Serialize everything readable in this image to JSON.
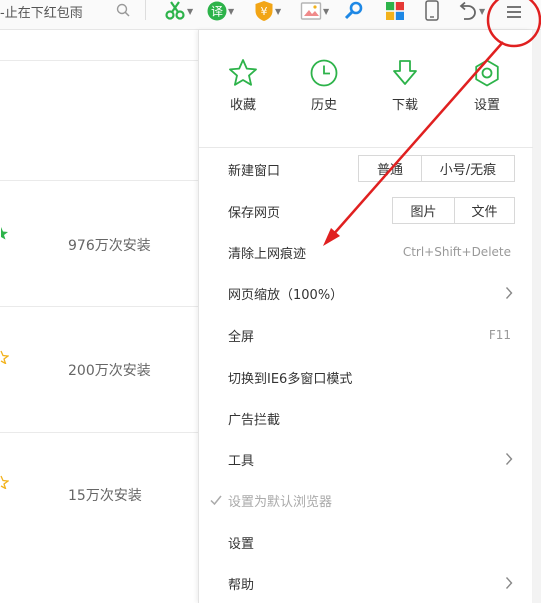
{
  "toolbar": {
    "search_text": "-止在下红包雨",
    "icons": [
      "scissors-icon",
      "translate-icon",
      "shield-icon",
      "image-icon",
      "search-icon",
      "apps-icon",
      "phone-icon",
      "undo-icon",
      "menu-icon"
    ],
    "translate_glyph": "译",
    "shield_glyph": "¥"
  },
  "page": {
    "rows": [
      {
        "install_count": "976万次安装",
        "star_color": "#2db34a"
      },
      {
        "install_count": "200万次安装",
        "star_color": "#f2b21c"
      },
      {
        "install_count": "15万次安装",
        "star_color": "#f2b21c"
      }
    ]
  },
  "menu": {
    "quick": [
      {
        "label": "收藏",
        "icon": "star-icon"
      },
      {
        "label": "历史",
        "icon": "clock-icon"
      },
      {
        "label": "下载",
        "icon": "download-icon"
      },
      {
        "label": "设置",
        "icon": "gear-icon"
      }
    ],
    "new_window": {
      "label": "新建窗口",
      "normal": "普通",
      "small": "小号/无痕"
    },
    "save_page": {
      "label": "保存网页",
      "image": "图片",
      "file": "文件"
    },
    "clear_traces": {
      "label": "清除上网痕迹",
      "shortcut": "Ctrl+Shift+Delete"
    },
    "zoom": {
      "label": "网页缩放（100%）"
    },
    "fullscreen": {
      "label": "全屏",
      "shortcut": "F11"
    },
    "ie6_mode": {
      "label": "切换到IE6多窗口模式"
    },
    "ad_block": {
      "label": "广告拦截"
    },
    "tools": {
      "label": "工具"
    },
    "default_browser": {
      "label": "设置为默认浏览器"
    },
    "settings": {
      "label": "设置"
    },
    "help": {
      "label": "帮助"
    }
  },
  "colors": {
    "accent_green": "#2db34a",
    "annotation_red": "#e02020"
  }
}
